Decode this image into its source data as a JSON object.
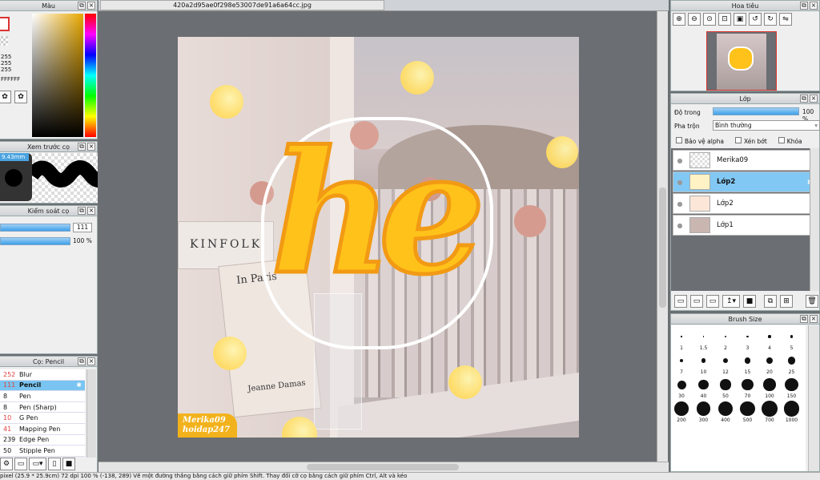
{
  "doc_tab": "420a2d95ae0f298e53007de91a6a64cc.jpg",
  "color_panel": {
    "title": "Màu",
    "v1": "255",
    "v2": "255",
    "v3": "255",
    "hex": "FFFFFF"
  },
  "brush_preview": {
    "title": "Xem trước cọ",
    "size": "9.43mm"
  },
  "brush_control": {
    "title": "Kiểm soát cọ",
    "size_value": "111",
    "opacity_value": "100 %",
    "size_fill": 1.0,
    "opacity_fill": 1.0
  },
  "brush_list": {
    "title": "Cọ: Pencil",
    "items": [
      {
        "n": "252",
        "label": "Blur",
        "color": "#e04040"
      },
      {
        "n": "111",
        "label": "Pencil",
        "color": "#e04040"
      },
      {
        "n": "8",
        "label": "Pen",
        "color": "#111"
      },
      {
        "n": "8",
        "label": "Pen (Sharp)",
        "color": "#111"
      },
      {
        "n": "10",
        "label": "G Pen",
        "color": "#e04040"
      },
      {
        "n": "41",
        "label": "Mapping Pen",
        "color": "#e04040"
      },
      {
        "n": "239",
        "label": "Edge Pen",
        "color": "#111"
      },
      {
        "n": "50",
        "label": "Stipple Pen",
        "color": "#111"
      }
    ]
  },
  "navigator": {
    "title": "Hoa tiêu"
  },
  "layers": {
    "title": "Lớp",
    "opacity_label": "Độ trong",
    "opacity_value": "100 %",
    "opacity_fill": 1.0,
    "blend_label": "Pha trộn",
    "blend_value": "Bình thường",
    "protect_alpha": "Bảo vệ alpha",
    "clipping": "Xén bớt",
    "lock": "Khóa",
    "items": [
      {
        "name": "Merika09"
      },
      {
        "name": "Lớp2"
      },
      {
        "name": "Lớp2"
      },
      {
        "name": "Lớp1"
      }
    ]
  },
  "brush_size": {
    "title": "Brush Size",
    "sizes": [
      "1",
      "1.5",
      "2",
      "3",
      "4",
      "5",
      "7",
      "10",
      "12",
      "15",
      "20",
      "25",
      "30",
      "40",
      "50",
      "70",
      "100",
      "150",
      "200",
      "300",
      "400",
      "500",
      "700",
      "1000"
    ]
  },
  "canvas": {
    "text": "he",
    "watermark1": "Merika09",
    "watermark2": "hoidap247",
    "book1": "In Paris",
    "book2": "Jeanne Damas",
    "book3": "KINFOLK"
  },
  "status": "pixel (25.9 * 25.9cm) 72 dpi 100 % (-138, 289) Vẽ một đường thẳng bằng cách giữ phím Shift. Thay đổi cỡ cọ bằng cách giữ phím Ctrl, Alt và kéo"
}
